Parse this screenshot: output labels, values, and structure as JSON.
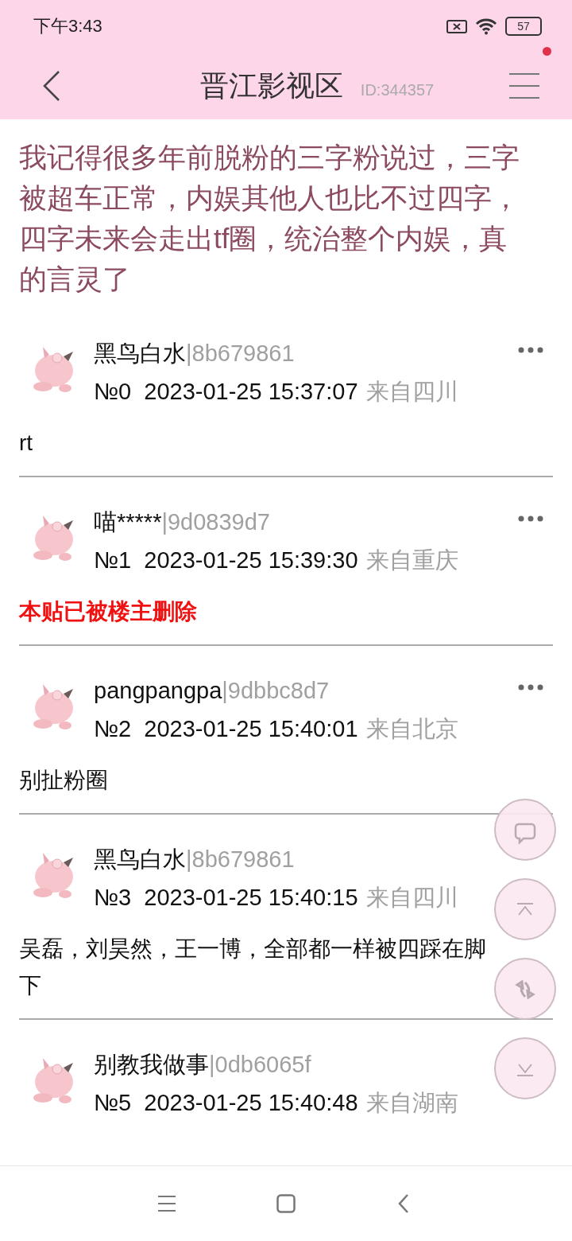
{
  "status_bar": {
    "time": "下午3:43",
    "battery": "57"
  },
  "header": {
    "title": "晋江影视区",
    "board_id": "ID:344357",
    "menu_badge": true
  },
  "post": {
    "title": "我记得很多年前脱粉的三字粉说过，三字被超车正常，内娱其他人也比不过四字，四字未来会走出tf圈，统治整个内娱，真的言灵了"
  },
  "replies": [
    {
      "author": "黑鸟白水",
      "hash": "|8b679861",
      "floor": "№0",
      "time": "2023-01-25 15:37:07",
      "location": "来自四川",
      "content": "rt",
      "deleted": false
    },
    {
      "author": "喵*****",
      "hash": "|9d0839d7",
      "floor": "№1",
      "time": "2023-01-25 15:39:30",
      "location": "来自重庆",
      "content": "本贴已被楼主删除",
      "deleted": true
    },
    {
      "author": "pangpangpa",
      "hash": "|9dbbc8d7",
      "floor": "№2",
      "time": "2023-01-25 15:40:01",
      "location": "来自北京",
      "content": "别扯粉圈",
      "deleted": false
    },
    {
      "author": "黑鸟白水",
      "hash": "|8b679861",
      "floor": "№3",
      "time": "2023-01-25 15:40:15",
      "location": "来自四川",
      "content": "吴磊，刘昊然，王一博，全部都一样被四踩在脚下",
      "deleted": false,
      "more_hidden": true
    },
    {
      "author": "别教我做事",
      "hash": "|0db6065f",
      "floor": "№5",
      "time": "2023-01-25 15:40:48",
      "location": "来自湖南",
      "more_hidden": true
    }
  ],
  "floating_buttons": [
    {
      "kind": "comment"
    },
    {
      "kind": "top"
    },
    {
      "kind": "refresh"
    },
    {
      "kind": "bottom"
    }
  ],
  "nav_bar": [
    {
      "kind": "menu"
    },
    {
      "kind": "home"
    },
    {
      "kind": "back"
    }
  ]
}
